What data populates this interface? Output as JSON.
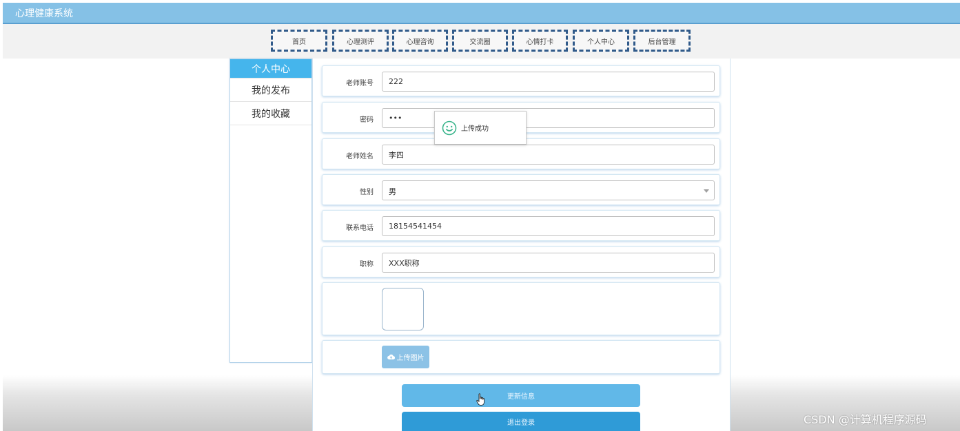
{
  "app": {
    "title": "心理健康系统"
  },
  "nav": {
    "items": [
      {
        "label": "首页"
      },
      {
        "label": "心理测评"
      },
      {
        "label": "心理咨询"
      },
      {
        "label": "交流圈"
      },
      {
        "label": "心情打卡"
      },
      {
        "label": "个人中心"
      },
      {
        "label": "后台管理"
      }
    ]
  },
  "sidebar": {
    "items": [
      {
        "label": "个人中心",
        "active": true
      },
      {
        "label": "我的发布"
      },
      {
        "label": "我的收藏"
      }
    ]
  },
  "form": {
    "account": {
      "label": "老师账号",
      "value": "222"
    },
    "password": {
      "label": "密码",
      "value": "•••"
    },
    "name": {
      "label": "老师姓名",
      "value": "李四"
    },
    "gender": {
      "label": "性别",
      "value": "男"
    },
    "phone": {
      "label": "联系电话",
      "value": "18154541454"
    },
    "title": {
      "label": "职称",
      "value": "XXX职称"
    },
    "upload_label": "上传图片"
  },
  "buttons": {
    "update": "更新信息",
    "logout": "退出登录"
  },
  "toast": {
    "message": "上传成功"
  },
  "watermark": "CSDN @计算机程序源码",
  "colors": {
    "header": "#85c1e6",
    "accent": "#45b5ec",
    "nav_border": "#305a8a",
    "update_button": "#61b8e8",
    "logout_button": "#2f9bd7",
    "toast_icon": "#3bb58c"
  }
}
